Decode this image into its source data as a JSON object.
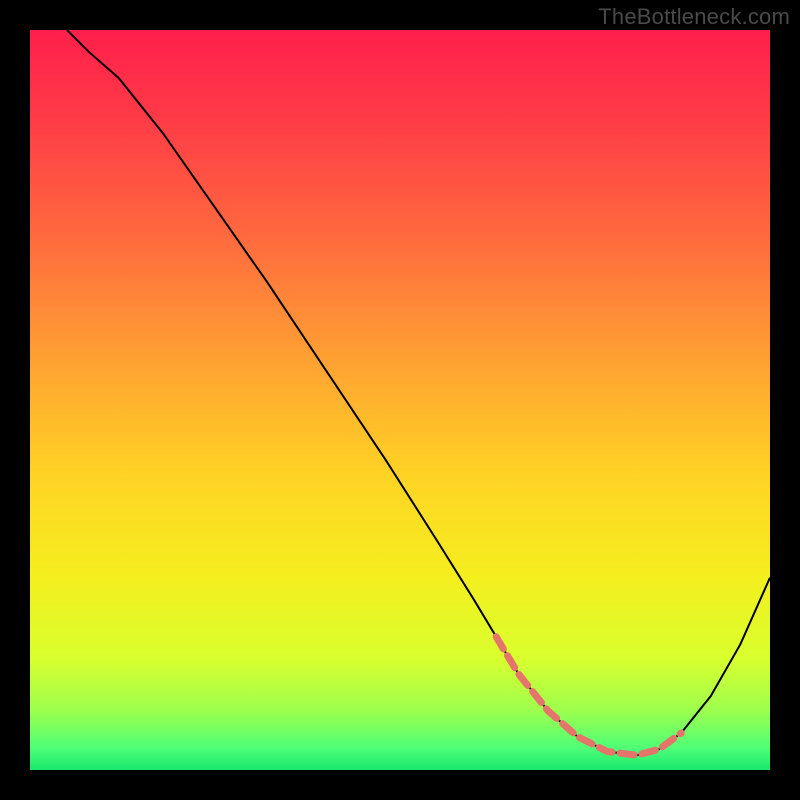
{
  "watermark": "TheBottleneck.com",
  "chart_data": {
    "type": "line",
    "title": "",
    "xlabel": "",
    "ylabel": "",
    "xlim": [
      0,
      100
    ],
    "ylim": [
      0,
      100
    ],
    "grid": false,
    "series": [
      {
        "name": "curve",
        "x": [
          5,
          8,
          12,
          18,
          25,
          32,
          40,
          48,
          55,
          60,
          63,
          66,
          70,
          74,
          78,
          82,
          85,
          88,
          92,
          96,
          100
        ],
        "y": [
          100,
          97,
          93.5,
          86,
          76,
          66,
          54,
          42,
          31,
          23,
          18,
          13,
          8,
          4.5,
          2.5,
          2,
          2.8,
          5,
          10,
          17,
          26
        ],
        "stroke": "#000000",
        "stroke_width": 2
      }
    ],
    "highlight_band": {
      "name": "dashed-highlight",
      "color": "#e5746b",
      "stroke_width": 7,
      "dash": "14 8",
      "x": [
        63,
        66,
        70,
        74,
        78,
        82,
        85,
        88
      ],
      "y": [
        18,
        13,
        8,
        4.5,
        2.5,
        2,
        2.8,
        5
      ]
    },
    "background_gradient": {
      "stops": [
        {
          "offset": 0.0,
          "color": "#ff1f4b"
        },
        {
          "offset": 0.12,
          "color": "#ff3b47"
        },
        {
          "offset": 0.28,
          "color": "#ff6a3e"
        },
        {
          "offset": 0.45,
          "color": "#ffa232"
        },
        {
          "offset": 0.6,
          "color": "#ffd324"
        },
        {
          "offset": 0.74,
          "color": "#f4ef1e"
        },
        {
          "offset": 0.85,
          "color": "#d9ff2e"
        },
        {
          "offset": 0.92,
          "color": "#9dff4e"
        },
        {
          "offset": 0.97,
          "color": "#4fff76"
        },
        {
          "offset": 1.0,
          "color": "#18e86e"
        }
      ]
    }
  }
}
